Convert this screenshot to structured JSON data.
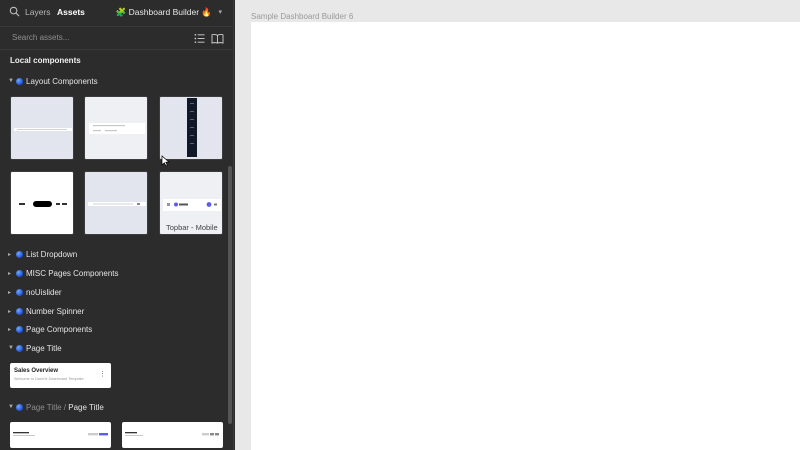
{
  "panel": {
    "tabs": {
      "layers": "Layers",
      "assets": "Assets"
    },
    "file_name": "🧩 Dashboard Builder 🔥",
    "search": {
      "placeholder": "Search assets..."
    },
    "section_title": "Local components",
    "groups": {
      "layout_components": "Layout Components",
      "list_dropdown": "List Dropdown",
      "misc_pages": "MISC Pages Components",
      "nouislider": "noUislider",
      "number_spinner": "Number Spinner",
      "page_components": "Page Components",
      "page_title": "Page Title",
      "page_title_path_parent": "Page Title / ",
      "page_title_path_child": "Page Title"
    },
    "thumb_caption": "Topbar - Mobile",
    "title_card": {
      "title": "Sales Overview",
      "subtitle": "Welcome to Dash'le Dashboard Template"
    }
  },
  "canvas": {
    "frame_label": "Sample Dashboard Builder 6"
  },
  "colors": {
    "panel_bg": "#2c2c2c",
    "canvas_bg": "#e8e8e8",
    "accent_blue": "#1d4fd8"
  }
}
